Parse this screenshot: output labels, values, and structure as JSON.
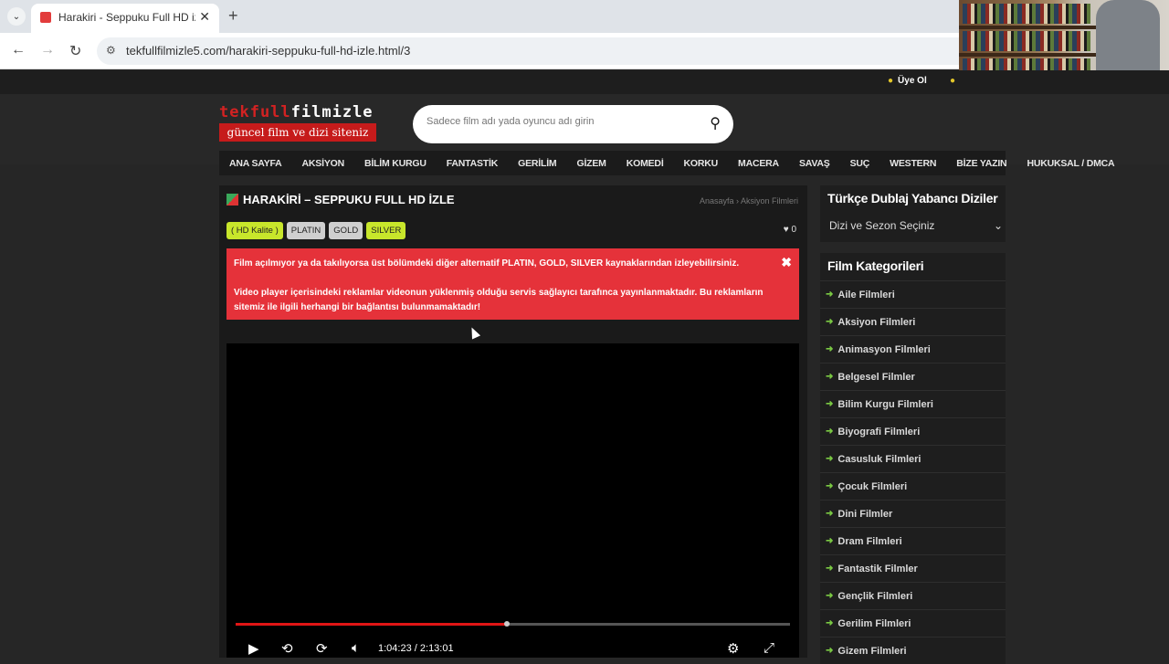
{
  "browser": {
    "tab_title": "Harakiri - Seppuku Full HD izle",
    "tab_close": "✕",
    "new_tab": "+",
    "url": "tekfullfilmizle5.com/harakiri-seppuku-full-hd-izle.html/3"
  },
  "topbar": {
    "register": "Üye Ol"
  },
  "logo": {
    "part_red": "tekfull",
    "part_white": "filmizle",
    "subtitle": "güncel film ve dizi siteniz"
  },
  "search": {
    "placeholder": "Sadece film adı yada oyuncu adı girin"
  },
  "nav": [
    "ANA SAYFA",
    "AKSİYON",
    "BİLİM KURGU",
    "FANTASTİK",
    "GERİLİM",
    "GİZEM",
    "KOMEDİ",
    "KORKU",
    "MACERA",
    "SAVAŞ",
    "SUÇ",
    "WESTERN",
    "BİZE YAZIN",
    "HUKUKSAL / DMCA"
  ],
  "post": {
    "title": "HARAKİRİ – SEPPUKU FULL HD İZLE",
    "breadcrumb": "Anasayfa › Aksiyon Filmleri",
    "badges": {
      "hd": "( HD Kalite )",
      "platin": "PLATIN",
      "gold": "GOLD",
      "silver": "SILVER"
    },
    "likes": "0",
    "alert_1": "Film açılmıyor ya da takılıyorsa üst bölümdeki diğer alternatif PLATIN, GOLD, SILVER kaynaklarından izleyebilirsiniz.",
    "alert_2": "Video player içerisindeki reklamlar videonun yüklenmiş olduğu servis sağlayıcı tarafınca yayınlanmaktadır. Bu reklamların sitemiz ile ilgili herhangi bir bağlantısı bulunmamaktadır!"
  },
  "player": {
    "current_time": "1:04:23",
    "separator": "/",
    "duration": "2:13:01",
    "progress": 0.49
  },
  "sidebar": {
    "dubbed_title": "Türkçe Dublaj Yabancı Diziler",
    "dubbed_select": "Dizi ve Sezon Seçiniz",
    "categories_title": "Film Kategorileri",
    "categories": [
      "Aile Filmleri",
      "Aksiyon Filmleri",
      "Animasyon Filmleri",
      "Belgesel Filmler",
      "Bilim Kurgu Filmleri",
      "Biyografi Filmleri",
      "Casusluk Filmleri",
      "Çocuk Filmleri",
      "Dini Filmler",
      "Dram Filmleri",
      "Fantastik Filmler",
      "Gençlik Filmleri",
      "Gerilim Filmleri",
      "Gizem Filmleri"
    ]
  },
  "colors": {
    "accent_red": "#e5323a",
    "badge_green": "#c8e62b",
    "progress_red": "#e01515"
  }
}
